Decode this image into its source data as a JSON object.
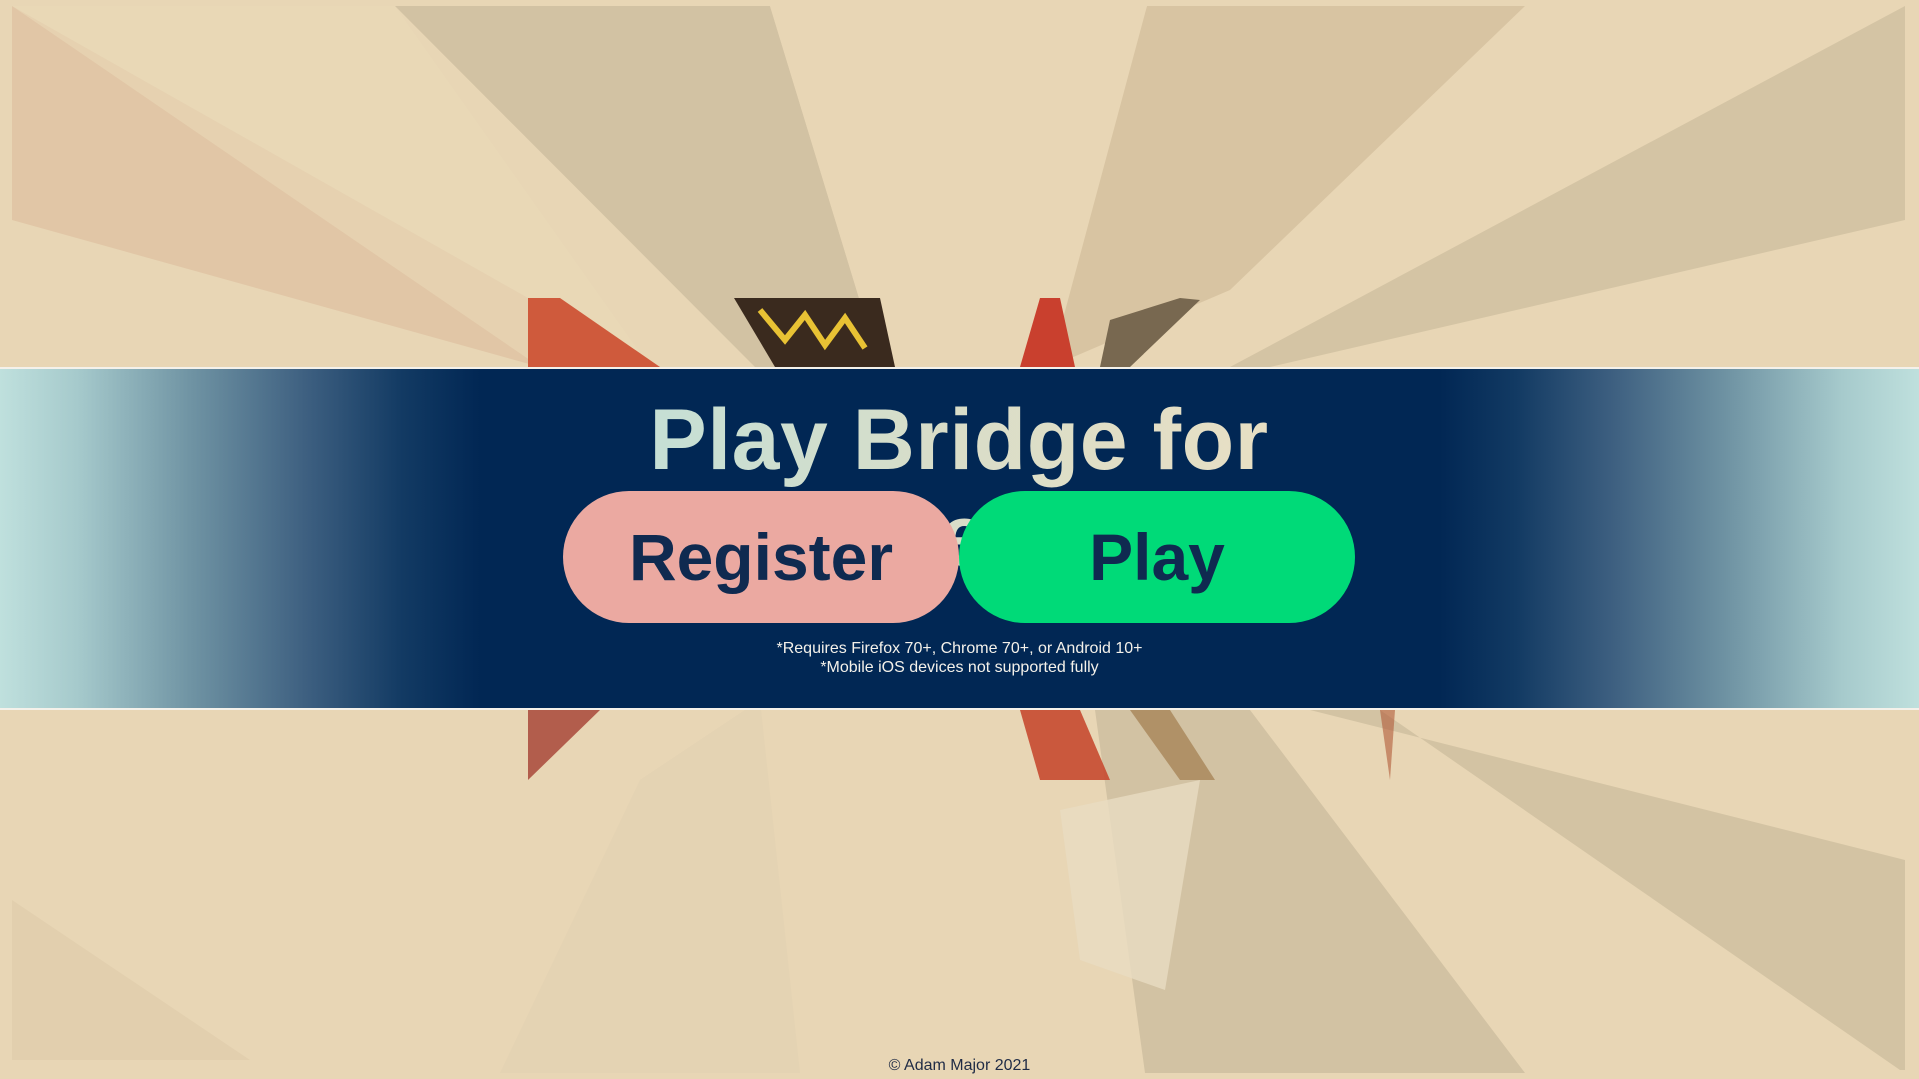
{
  "hero": {
    "title": "Play Bridge for Free!",
    "register_label": "Register",
    "play_label": "Play",
    "requirements_note": "*Requires Firefox 70+, Chrome 70+, or Android 10+",
    "mobile_note": "*Mobile iOS devices not supported fully"
  },
  "footer": {
    "copyright": "© Adam Major 2021"
  },
  "colors": {
    "background": "#e8d6b5",
    "banner": "#012754",
    "register_button": "#eba9a1",
    "play_button": "#00da78",
    "button_text": "#0f2a50"
  }
}
